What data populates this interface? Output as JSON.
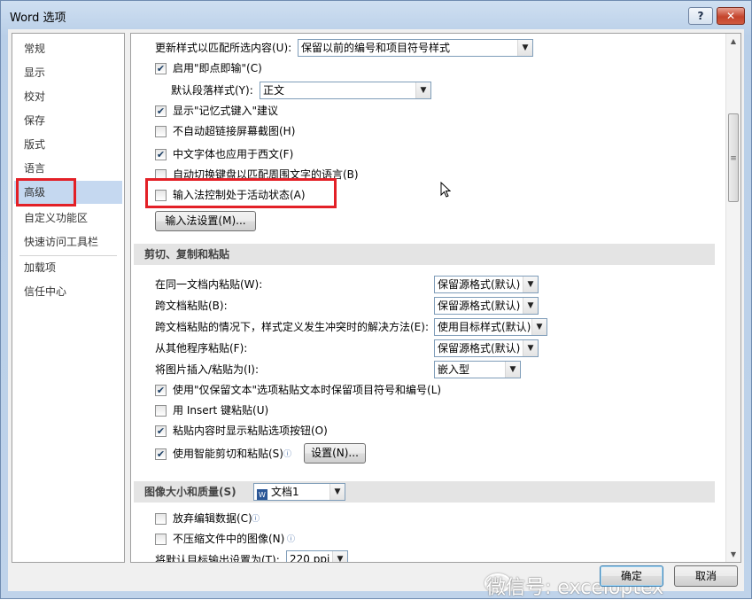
{
  "window": {
    "title": "Word 选项",
    "help_label": "?",
    "close_label": "✕"
  },
  "nav": {
    "items": [
      "常规",
      "显示",
      "校对",
      "保存",
      "版式",
      "语言",
      "高级",
      "自定义功能区",
      "快速访问工具栏",
      "加载项",
      "信任中心"
    ],
    "selected": "高级"
  },
  "content": {
    "update_style": {
      "label": "更新样式以匹配所选内容(U):",
      "value": "保留以前的编号和项目符号样式"
    },
    "click_and_type": {
      "label": "启用\"即点即输\"(C)",
      "checked": true
    },
    "default_paragraph_style": {
      "label": "默认段落样式(Y):",
      "value": "正文"
    },
    "show_autocomplete": {
      "label": "显示\"记忆式键入\"建议",
      "checked": true
    },
    "no_auto_hyperlink_screenshot": {
      "label": "不自动超链接屏幕截图(H)",
      "checked": false
    },
    "chinese_font_for_western": {
      "label": "中文字体也应用于西文(F)",
      "checked": true
    },
    "auto_switch_keyboard": {
      "label": "自动切换键盘以匹配周围文字的语言(B)",
      "checked": false
    },
    "ime_control_active": {
      "label": "输入法控制处于活动状态(A)",
      "checked": false
    },
    "ime_settings_button": "输入法设置(M)...",
    "cut_copy_paste": {
      "header": "剪切、复制和粘贴",
      "paste_options": [
        {
          "label": "在同一文档内粘贴(W):",
          "value": "保留源格式(默认)"
        },
        {
          "label": "跨文档粘贴(B):",
          "value": "保留源格式(默认)"
        },
        {
          "label": "跨文档粘贴的情况下，样式定义发生冲突时的解决方法(E):",
          "value": "使用目标样式(默认)"
        },
        {
          "label": "从其他程序粘贴(F):",
          "value": "保留源格式(默认)"
        },
        {
          "label": "将图片插入/粘贴为(I):",
          "value": "嵌入型"
        }
      ],
      "keep_bullets": {
        "label": "使用\"仅保留文本\"选项粘贴文本时保留项目符号和编号(L)",
        "checked": true
      },
      "insert_key_paste": {
        "label": "用 Insert 键粘贴(U)",
        "checked": false
      },
      "show_paste_options": {
        "label": "粘贴内容时显示粘贴选项按钮(O)",
        "checked": true
      },
      "smart_cut_paste": {
        "label": "使用智能剪切和粘贴(S)",
        "checked": true
      },
      "settings_button": "设置(N)..."
    },
    "image_quality": {
      "header": "图像大小和质量(S)",
      "document": "文档1",
      "discard_edit_data": {
        "label": "放弃编辑数据(C)",
        "checked": false
      },
      "no_compress": {
        "label": "不压缩文件中的图像(N)",
        "checked": false
      },
      "default_target_output": {
        "label": "将默认目标输出设置为(T):",
        "value": "220 ppi"
      }
    }
  },
  "footer": {
    "ok_label": "确定",
    "cancel_label": "取消"
  },
  "watermark": "微信号: exceloptex",
  "colors": {
    "highlight_box": "#e32027",
    "nav_selected": "#c5d8f0",
    "section_header": "#e4e4e4"
  }
}
